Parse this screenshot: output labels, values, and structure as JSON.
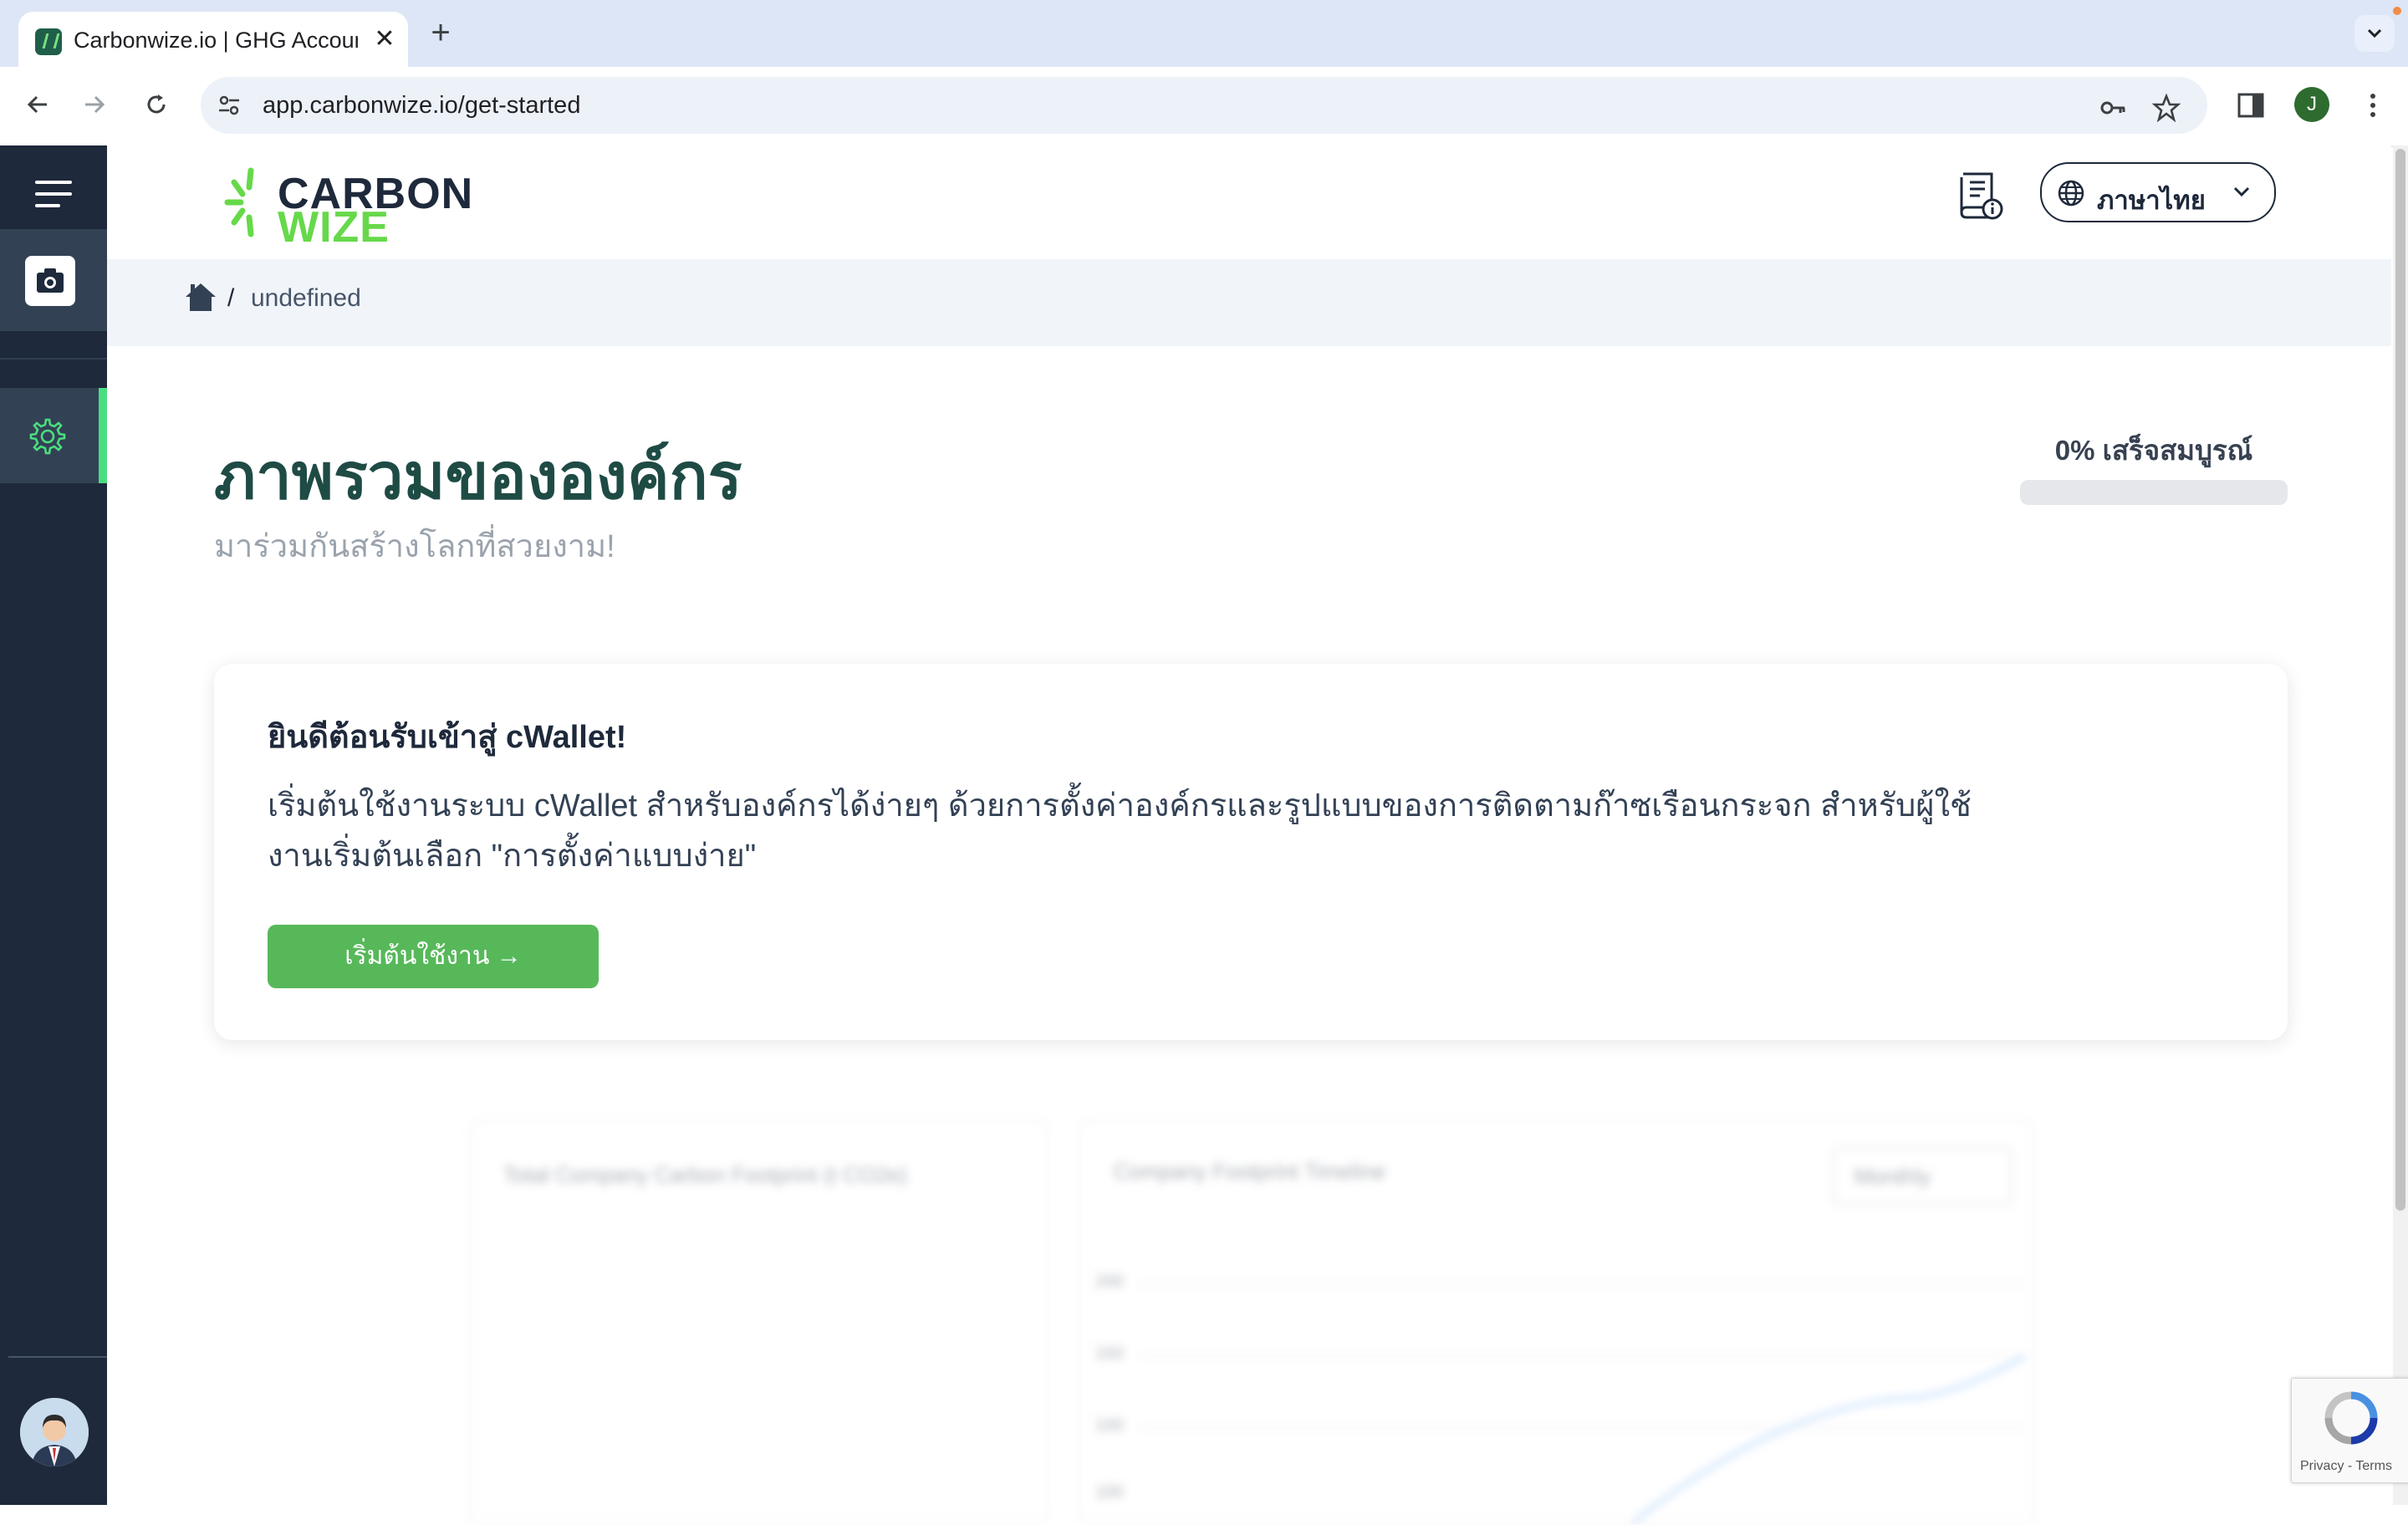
{
  "browser": {
    "tab_title": "Carbonwize.io | GHG Accoun",
    "tab_close": "✕",
    "new_tab": "+",
    "url": "app.carbonwize.io/get-started",
    "profile_initial": "J"
  },
  "header": {
    "logo_line1": "CARBON",
    "logo_line2": "WIZE",
    "language": "ภาษาไทย"
  },
  "breadcrumb": {
    "separator": "/",
    "current": "undefined"
  },
  "page": {
    "title": "ภาพรวมขององค์กร",
    "subtitle": "มาร่วมกันสร้างโลกที่สวยงาม!",
    "progress_label": "0% เสร็จสมบูรณ์",
    "progress_percent": 0
  },
  "welcome_card": {
    "title": "ยินดีต้อนรับเข้าสู่ cWallet!",
    "body": "เริ่มต้นใช้งานระบบ cWallet สำหรับองค์กรได้ง่ายๆ ด้วยการตั้งค่าองค์กรและรูปแบบของการติดตามก๊าซเรือนกระจก สำหรับผู้ใช้งานเริ่มต้นเลือก \"การตั้งค่าแบบง่าย\"",
    "button_label": "เริ่มต้นใช้งาน →"
  },
  "background_widgets": {
    "card1_title": "Total Company Carbon Footprint (t CO2e)",
    "card2_title": "Company Footprint Timeline",
    "period_select": "Monthly",
    "y_ticks": [
      "200",
      "150",
      "100",
      "100"
    ]
  },
  "recaptcha": {
    "footer": "Privacy - Terms"
  },
  "colors": {
    "sidebar": "#1e293b",
    "accent_green": "#4ade80",
    "button_green": "#57b85a",
    "title_teal": "#1f4b45"
  }
}
